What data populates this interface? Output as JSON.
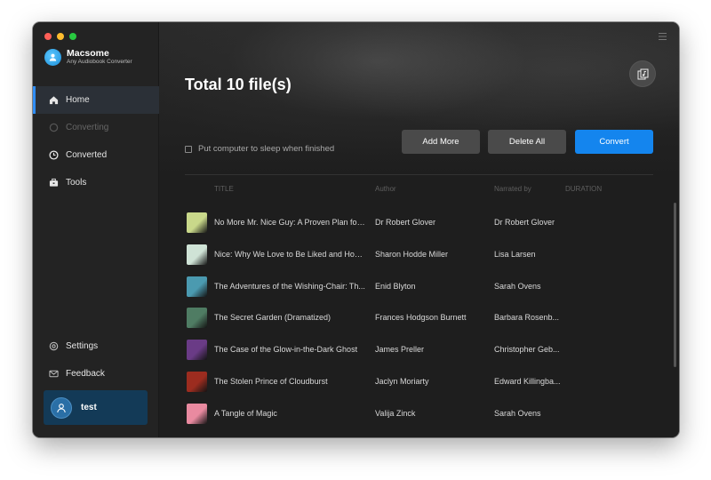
{
  "app": {
    "name": "Macsome",
    "subtitle": "Any Audiobook Converter"
  },
  "sidebar": {
    "items": [
      {
        "label": "Home",
        "icon": "home-icon",
        "state": "active"
      },
      {
        "label": "Converting",
        "icon": "converting-icon",
        "state": "disabled"
      },
      {
        "label": "Converted",
        "icon": "clock-icon",
        "state": "normal"
      },
      {
        "label": "Tools",
        "icon": "toolbox-icon",
        "state": "normal"
      }
    ],
    "bottom_items": [
      {
        "label": "Settings",
        "icon": "gear-icon"
      },
      {
        "label": "Feedback",
        "icon": "mail-icon"
      }
    ],
    "user": {
      "name": "test"
    }
  },
  "main": {
    "total_label": "Total 10 file(s)",
    "sleep_label": "Put computer to sleep when finished",
    "buttons": {
      "add": "Add More",
      "delete": "Delete All",
      "convert": "Convert"
    },
    "columns": {
      "title": "TITLE",
      "author": "Author",
      "narrated": "Narrated by",
      "duration": "DURATION"
    },
    "rows": [
      {
        "title": "No More Mr. Nice Guy: A Proven Plan for ...",
        "author": "Dr Robert Glover",
        "narrator": "Dr Robert Glover",
        "cover_color": "#c9d88a"
      },
      {
        "title": "Nice: Why We Love to Be Liked and How ...",
        "author": "Sharon Hodde Miller",
        "narrator": "Lisa Larsen",
        "cover_color": "#cfe3d6"
      },
      {
        "title": "The Adventures of the Wishing-Chair: Th...",
        "author": "Enid Blyton",
        "narrator": "Sarah Ovens",
        "cover_color": "#4b9ab0"
      },
      {
        "title": "The Secret Garden (Dramatized)",
        "author": "Frances Hodgson Burnett",
        "narrator": "Barbara Rosenb...",
        "cover_color": "#4f7c63"
      },
      {
        "title": "The Case of the Glow-in-the-Dark Ghost",
        "author": "James Preller",
        "narrator": "Christopher Geb...",
        "cover_color": "#6a3b86"
      },
      {
        "title": "The Stolen Prince of Cloudburst",
        "author": "Jaclyn Moriarty",
        "narrator": "Edward Killingba...",
        "cover_color": "#9c2c1f"
      },
      {
        "title": "A Tangle of Magic",
        "author": "Valija Zinck",
        "narrator": "Sarah Ovens",
        "cover_color": "#e98aa0"
      }
    ]
  },
  "colors": {
    "accent": "#1485ee",
    "sidebar_bg": "#232323",
    "main_bg": "#1e1e1e"
  }
}
